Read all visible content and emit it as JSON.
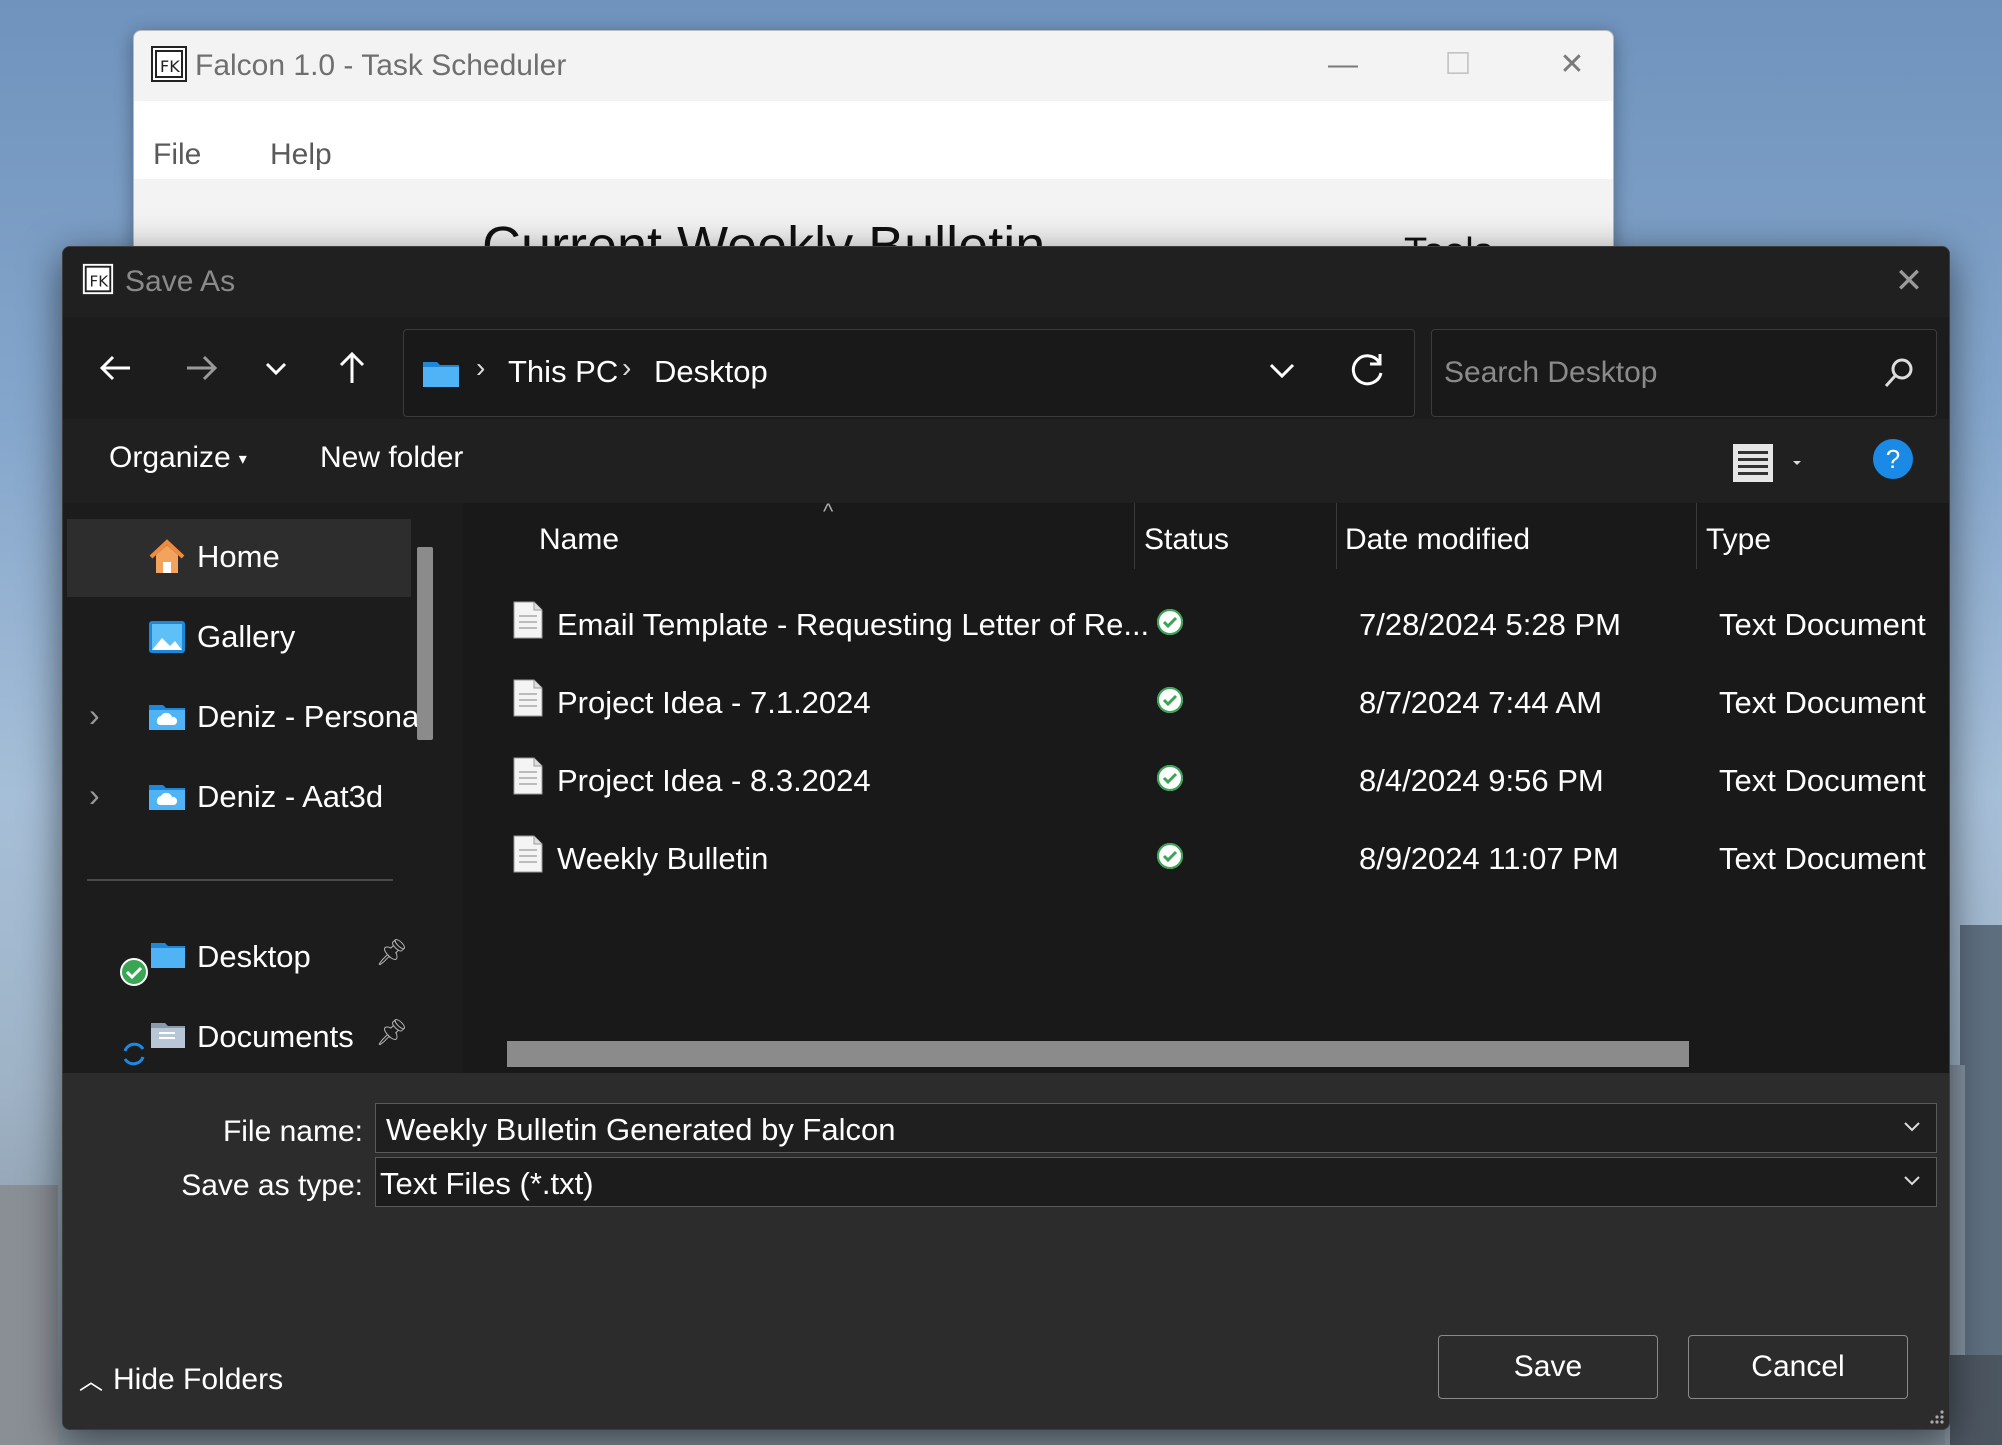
{
  "background_window": {
    "title": "Falcon 1.0 - Task Scheduler",
    "menu": [
      "File",
      "Help"
    ],
    "heading": "Current Weekly Bulletin",
    "tools_label": "Tools",
    "controls": {
      "minimize": "—",
      "maximize": "☐",
      "close": "✕"
    }
  },
  "dialog": {
    "title": "Save As",
    "close": "✕",
    "breadcrumb": [
      "This PC",
      "Desktop"
    ],
    "search_placeholder": "Search Desktop",
    "commands": {
      "organize": "Organize",
      "new_folder": "New folder",
      "help": "?"
    },
    "nav_items": [
      {
        "label": "Home",
        "icon": "home-icon"
      },
      {
        "label": "Gallery",
        "icon": "gallery-icon"
      },
      {
        "label": "Deniz - Personal",
        "icon": "onedrive-folder-icon"
      },
      {
        "label": "Deniz - Aat3d",
        "icon": "onedrive-folder-icon"
      },
      {
        "label": "Desktop",
        "icon": "desktop-folder-icon"
      },
      {
        "label": "Documents",
        "icon": "documents-folder-icon"
      }
    ],
    "columns": [
      "Name",
      "Status",
      "Date modified",
      "Type"
    ],
    "files": [
      {
        "name": "Email Template - Requesting Letter of Re...",
        "date": "7/28/2024 5:28 PM",
        "type": "Text Document"
      },
      {
        "name": "Project Idea - 7.1.2024",
        "date": "8/7/2024 7:44 AM",
        "type": "Text Document"
      },
      {
        "name": "Project Idea - 8.3.2024",
        "date": "8/4/2024 9:56 PM",
        "type": "Text Document"
      },
      {
        "name": "Weekly Bulletin",
        "date": "8/9/2024 11:07 PM",
        "type": "Text Document"
      }
    ],
    "file_name_label": "File name:",
    "file_name_value": "Weekly Bulletin Generated by Falcon",
    "save_type_label": "Save as type:",
    "save_type_value": "Text Files (*.txt)",
    "save_button": "Save",
    "cancel_button": "Cancel",
    "hide_folders": "Hide Folders"
  },
  "colors": {
    "accent": "#1b8ae6",
    "synced_green": "#3aa655",
    "dialog_bg": "#202020"
  }
}
